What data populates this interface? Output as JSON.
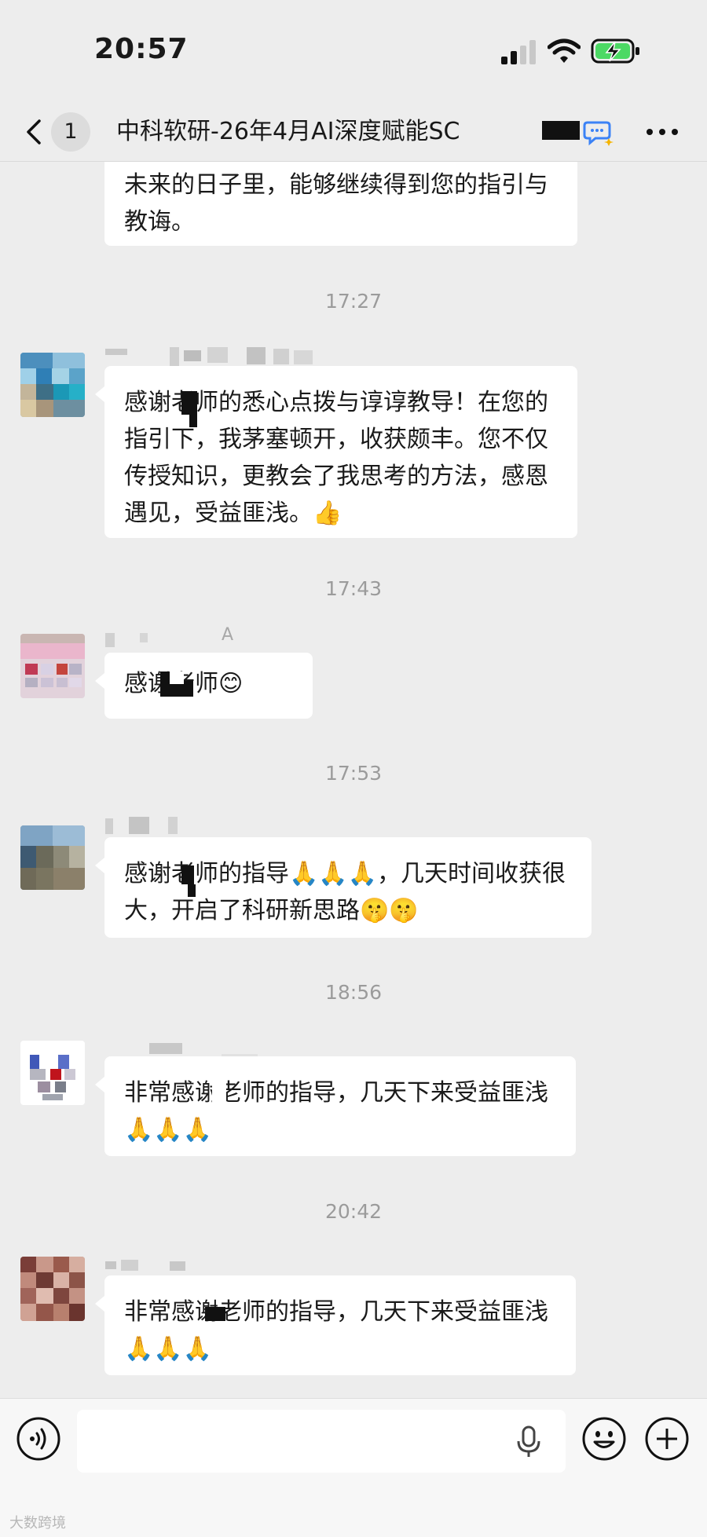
{
  "status_bar": {
    "time": "20:57"
  },
  "nav": {
    "unread_count": "1",
    "title": "中科软研-26年4月AI深度赋能SC"
  },
  "messages": [
    {
      "text": "未来的日子里，能够继续得到您的指引与教诲。"
    },
    {
      "time": "17:27",
      "text": "感谢老师的悉心点拨与谆谆教导！在您的指引下，我茅塞顿开，收获颇丰。您不仅传授知识，更教会了我思考的方法，感恩遇见，受益匪浅。👍"
    },
    {
      "time": "17:43",
      "name_fragment": "A",
      "text": "感谢老师😊"
    },
    {
      "time": "17:53",
      "text": "感谢老师的指导🙏🙏🙏，几天时间收获很大，开启了科研新思路🤫🤫"
    },
    {
      "time": "18:56",
      "text": "非常感谢老师的指导，几天下来受益匪浅🙏🙏🙏"
    },
    {
      "time": "20:42",
      "text": "非常感谢老师的指导，几天下来受益匪浅🙏🙏🙏"
    }
  ],
  "watermark": "大数跨境",
  "icons": {
    "back": "chevron-left-icon",
    "more": "more-dots-icon",
    "voice": "voice-icon",
    "mic": "mic-icon",
    "emoji": "emoji-icon",
    "plus": "plus-icon"
  },
  "colors": {
    "background": "#ededed",
    "bubble": "#ffffff",
    "timestamp": "#9b9b9b"
  }
}
